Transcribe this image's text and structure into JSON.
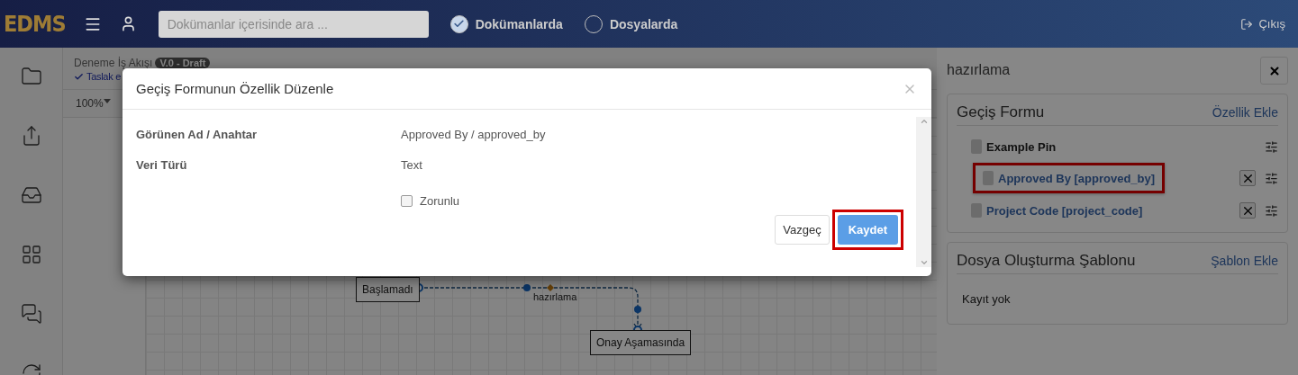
{
  "header": {
    "logo": "EDMS",
    "search": {
      "placeholder": "Dokümanlar içerisinde ara ..."
    },
    "scopes": [
      {
        "label": "Dokümanlarda",
        "selected": true
      },
      {
        "label": "Dosyalarda",
        "selected": false
      }
    ],
    "logout": "Çıkış"
  },
  "workflow": {
    "name": "Deneme İş Akışı",
    "version": "V.0 - Draft",
    "status": "Taslak e",
    "zoom": "100%"
  },
  "diagram": {
    "nodes": [
      {
        "label": "Başlamadı"
      },
      {
        "label": "Onay Aşamasında"
      }
    ],
    "edge_label": "hazırlama"
  },
  "panel": {
    "title": "hazırlama",
    "form_card": {
      "title": "Geçiş Formu",
      "action": "Özellik Ekle",
      "groups": [
        {
          "label": "Example Pin",
          "children": [
            {
              "label": "Approved By [approved_by]",
              "highlighted": true
            }
          ]
        },
        {
          "label": "Project Code [project_code]",
          "highlighted": false
        }
      ]
    },
    "template_card": {
      "title": "Dosya Oluşturma Şablonu",
      "action": "Şablon Ekle",
      "empty": "Kayıt yok"
    }
  },
  "modal": {
    "title": "Geçiş Formunun Özellik Düzenle",
    "fields": [
      {
        "label": "Görünen Ad / Anahtar",
        "value": "Approved By / approved_by"
      },
      {
        "label": "Veri Türü",
        "value": "Text"
      }
    ],
    "required": {
      "label": "Zorunlu",
      "checked": false
    },
    "cancel": "Vazgeç",
    "save": {
      "label": "Kaydet",
      "highlighted": true
    }
  }
}
